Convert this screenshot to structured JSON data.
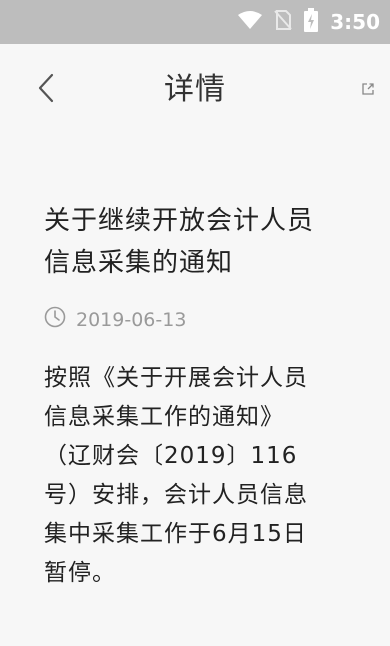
{
  "status_bar": {
    "time": "3:50",
    "icons": [
      "wifi-icon",
      "no-sim-icon",
      "battery-charging-icon"
    ]
  },
  "header": {
    "back_icon": "chevron-left-icon",
    "title": "详情",
    "share_icon": "share-icon"
  },
  "article": {
    "title": "关于继续开放会计人员\n信息采集的通知",
    "date_icon": "clock-icon",
    "date": "2019-06-13",
    "body": "按照《关于开展会计人员\n信息采集工作的通知》\n（辽财会〔2019〕116\n号）安排，会计人员信息\n集中采集工作于6月15日\n暂停。"
  },
  "colors": {
    "status_bar_bg": "#bdbdbd",
    "page_bg": "#f7f7f7",
    "muted_text": "#9a9a9a"
  }
}
